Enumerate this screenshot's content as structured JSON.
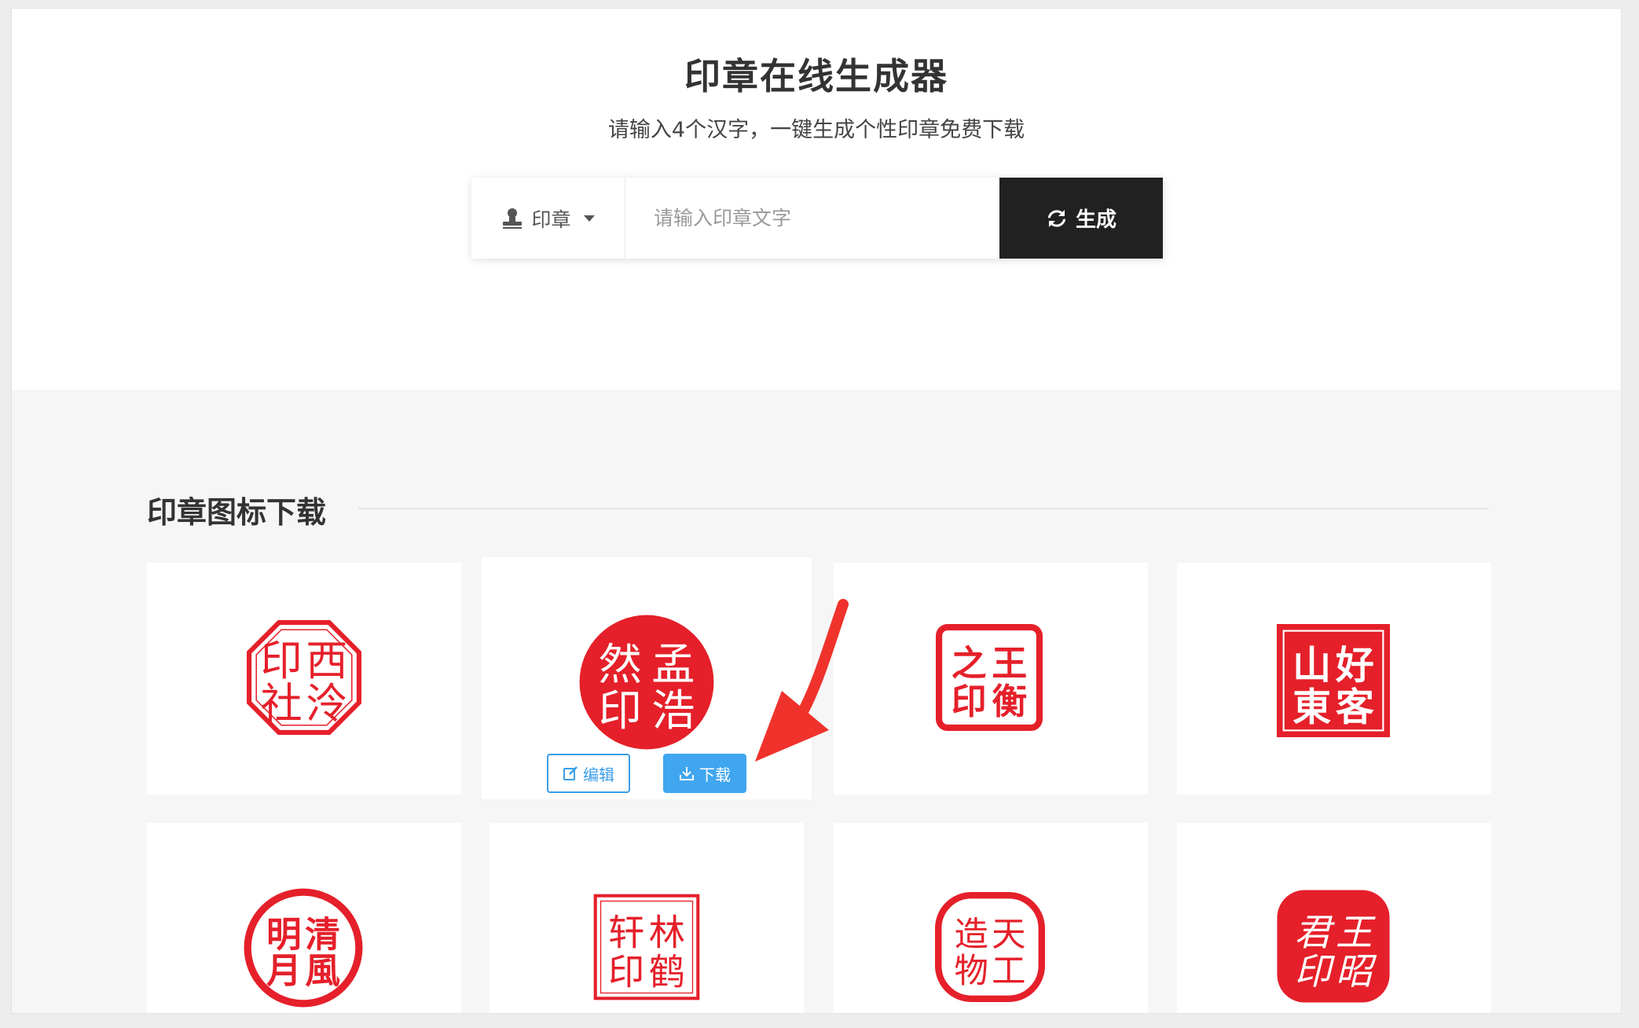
{
  "header": {
    "title": "印章在线生成器",
    "subtitle": "请输入4个汉字，一键生成个性印章免费下载"
  },
  "search": {
    "type_label": "印章",
    "placeholder": "请输入印章文字",
    "value": "",
    "generate_label": "生成"
  },
  "section": {
    "title": "印章图标下载"
  },
  "cards": [
    {
      "chars": [
        "印",
        "西",
        "社",
        "泠"
      ]
    },
    {
      "chars": [
        "然",
        "孟",
        "印",
        "浩"
      ],
      "edit_label": "编辑",
      "download_label": "下载"
    },
    {
      "chars": [
        "之",
        "王",
        "印",
        "衡"
      ]
    },
    {
      "chars": [
        "山",
        "好",
        "東",
        "客"
      ]
    },
    {
      "chars": [
        "明",
        "清",
        "月",
        "風"
      ]
    },
    {
      "chars": [
        "轩",
        "林",
        "印",
        "鹤"
      ]
    },
    {
      "chars": [
        "造",
        "天",
        "物",
        "工"
      ]
    },
    {
      "chars": [
        "君",
        "王",
        "印",
        "昭"
      ]
    }
  ],
  "colors": {
    "seal_red": "#e5202a",
    "button_dark": "#212121",
    "accent_blue": "#3a9ee8",
    "arrow_red": "#f0322c"
  }
}
